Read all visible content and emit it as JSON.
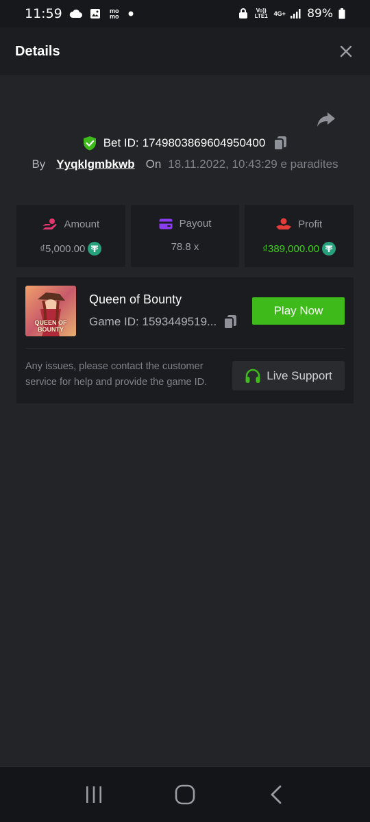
{
  "status_bar": {
    "time": "11:59",
    "momo_label": "mo mo",
    "volte_label": "Vo)) LTE1",
    "network_label": "4G+",
    "battery": "89%"
  },
  "header": {
    "title": "Details"
  },
  "bet": {
    "label": "Bet ID:",
    "id": "1749803869604950400",
    "by_label": "By",
    "username": "Yyqklgmbkwb",
    "on_label": "On",
    "date": "18.11.2022, 10:43:29 e paradites"
  },
  "stats": {
    "amount": {
      "label": "Amount",
      "value": "₫5,000.00"
    },
    "payout": {
      "label": "Payout",
      "value": "78.8 x"
    },
    "profit": {
      "label": "Profit",
      "value": "₫389,000.00"
    }
  },
  "game": {
    "name": "Queen of Bounty",
    "thumb_text": "QUEEN OF BOUNTY",
    "id_label": "Game ID:",
    "id_value": "1593449519...",
    "play_label": "Play Now",
    "note": "Any issues, please contact the customer service for help and provide the game ID.",
    "support_label": "Live Support"
  },
  "colors": {
    "accent_green": "#3ebb1a",
    "profit_green": "#3fd11d",
    "coin": "#26a17b",
    "amount_icon": "#e6366f",
    "payout_icon": "#8b3cf5",
    "profit_icon": "#e43b3b"
  },
  "icons": {
    "status": [
      "cloud-icon",
      "gallery-icon",
      "momo-icon",
      "dot-icon",
      "lock-icon",
      "signal-icon",
      "battery-icon"
    ],
    "header": [
      "close-icon"
    ],
    "bet": [
      "share-icon",
      "shield-check-icon",
      "copy-icon"
    ],
    "stats": [
      "hand-coins-icon",
      "card-icon",
      "hand-heart-icon",
      "tether-icon"
    ],
    "game": [
      "copy-icon",
      "headset-icon"
    ],
    "nav": [
      "recents-icon",
      "home-icon",
      "back-icon"
    ]
  }
}
